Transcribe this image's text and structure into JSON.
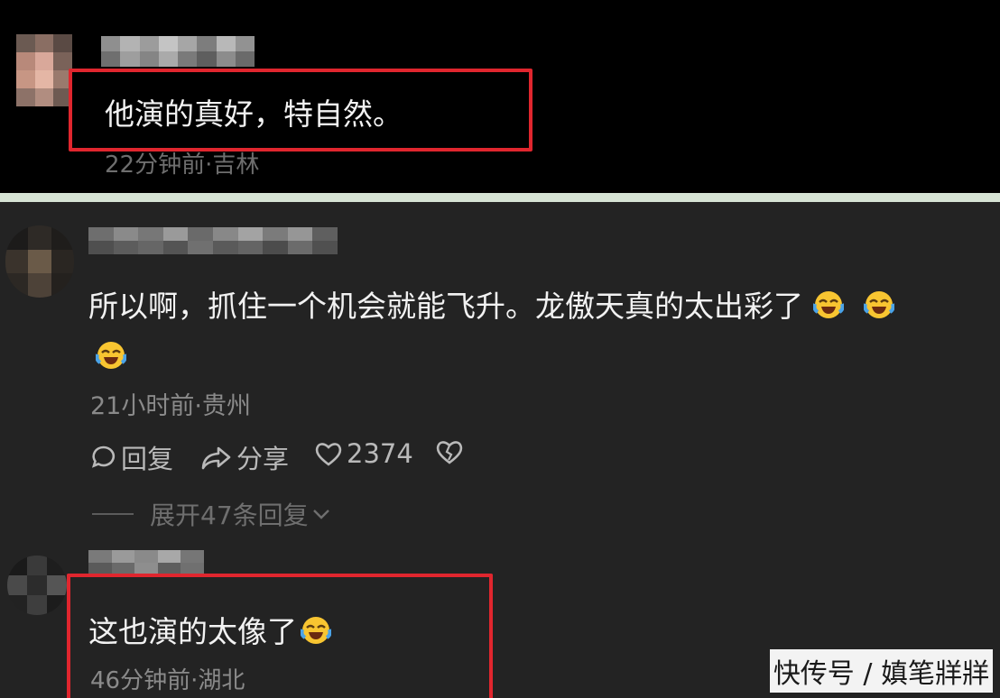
{
  "comments": [
    {
      "text": "他演的真好，特自然。",
      "meta": "22分钟前·吉林"
    },
    {
      "text": "所以啊，抓住一个机会就能飞升。龙傲天真的太出彩了",
      "meta": "21小时前·贵州",
      "actions": {
        "reply": "回复",
        "share": "分享",
        "likes": "2374"
      },
      "expand_replies": "展开47条回复"
    },
    {
      "text": "这也演的太像了",
      "meta": "46分钟前·湖北"
    }
  ],
  "watermark": "快传号 / 嫃笔牂牂",
  "colors": {
    "highlight_box": "#e0262e",
    "top_panel_bg": "#000000",
    "bottom_panel_bg": "#232323"
  }
}
